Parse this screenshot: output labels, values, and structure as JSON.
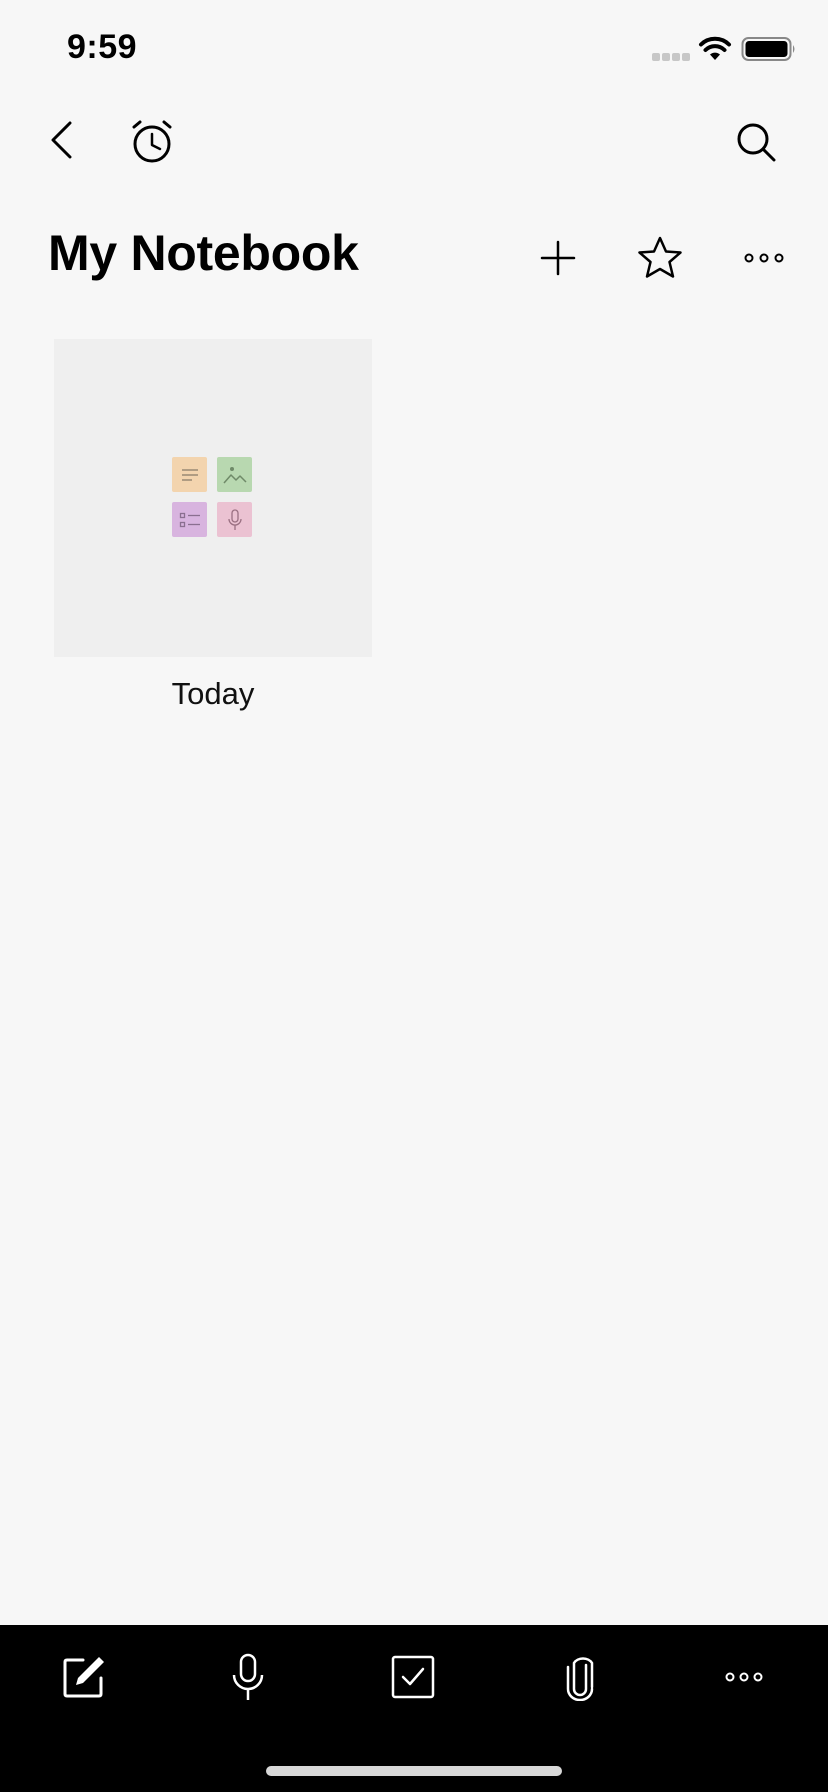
{
  "status_bar": {
    "time": "9:59"
  },
  "nav": {
    "back_icon": "chevron-left-icon",
    "reminder_icon": "alarm-clock-icon",
    "search_icon": "search-icon"
  },
  "header": {
    "title": "My Notebook",
    "add_icon": "plus-icon",
    "favorite_icon": "star-icon",
    "more_icon": "more-horizontal-icon"
  },
  "notes": [
    {
      "label": "Today",
      "tiles": [
        {
          "icon": "text-lines-icon",
          "color": "#f3d4ae"
        },
        {
          "icon": "image-icon",
          "color": "#b8d8b0"
        },
        {
          "icon": "list-icon",
          "color": "#d8b4df"
        },
        {
          "icon": "microphone-icon",
          "color": "#ebc2d2"
        }
      ]
    }
  ],
  "toolbar": {
    "items": [
      {
        "icon": "pencil-square-icon"
      },
      {
        "icon": "microphone-icon"
      },
      {
        "icon": "checkbox-icon"
      },
      {
        "icon": "paperclip-icon"
      },
      {
        "icon": "more-horizontal-icon"
      }
    ]
  },
  "colors": {
    "background": "#f7f7f7",
    "card": "#efefef",
    "toolbar": "#000000"
  }
}
